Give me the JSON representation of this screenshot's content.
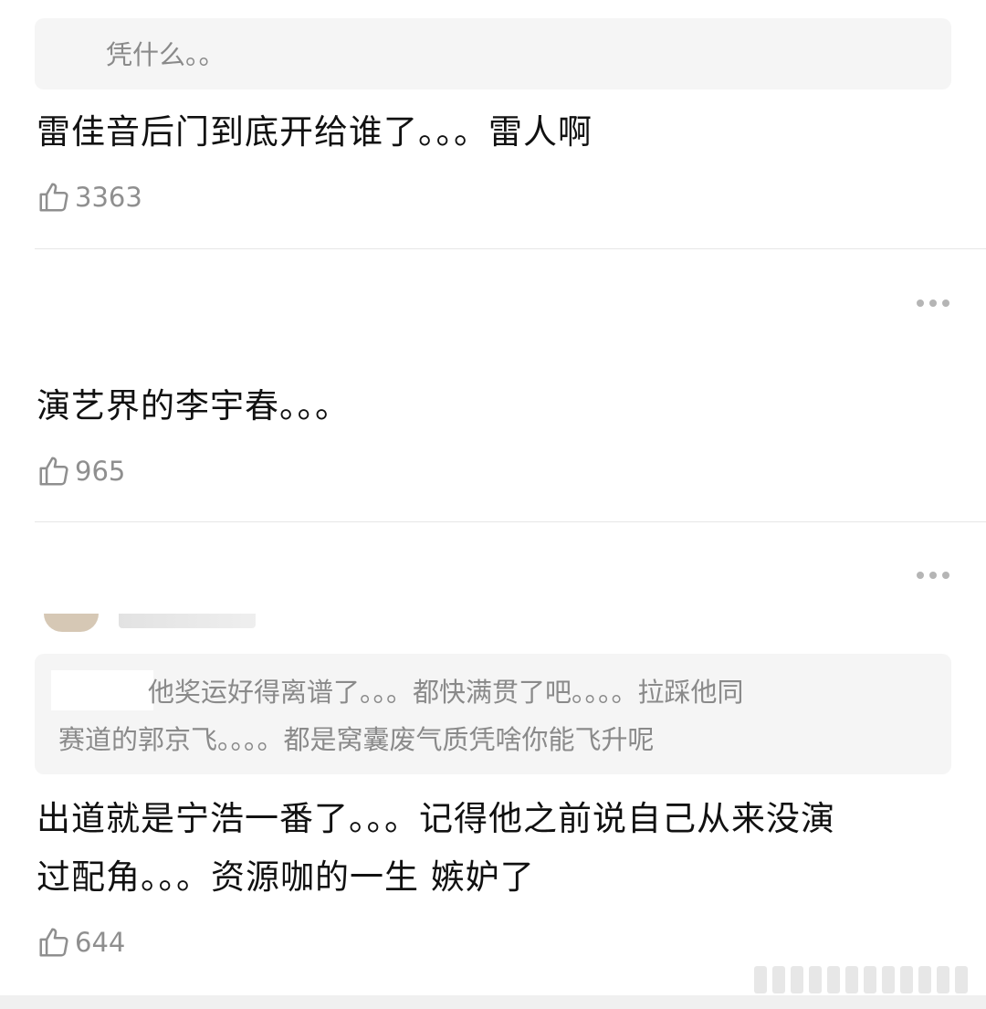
{
  "comments": [
    {
      "quote": "凭什么。。",
      "text": "雷佳音后门到底开给谁了。。。雷人啊",
      "likes": "3363"
    },
    {
      "text": "演艺界的李宇春。。。",
      "likes": "965"
    },
    {
      "quote": "他奖运好得离谱了。。。都快满贯了吧。。。。拉踩他同赛道的郭京飞。。。。都是窝囊废气质凭啥你能飞升呢",
      "quote_line1": "他奖运好得离谱了。。。都快满贯了吧。。。。拉踩他同",
      "quote_line2": "赛道的郭京飞。。。。都是窝囊废气质凭啥你能飞升呢",
      "text_line1": "出道就是宁浩一番了。。。记得他之前说自己从来没演",
      "text_line2": "过配角。。。资源咖的一生 嫉妒了",
      "likes": "644"
    }
  ],
  "icons": {
    "like": "thumbs-up-icon",
    "more": "more-dots-icon"
  },
  "colors": {
    "quote_bg": "#f5f5f5",
    "muted_text": "#8a8a8a",
    "body_text": "#111111",
    "divider": "#e6e6e6"
  }
}
